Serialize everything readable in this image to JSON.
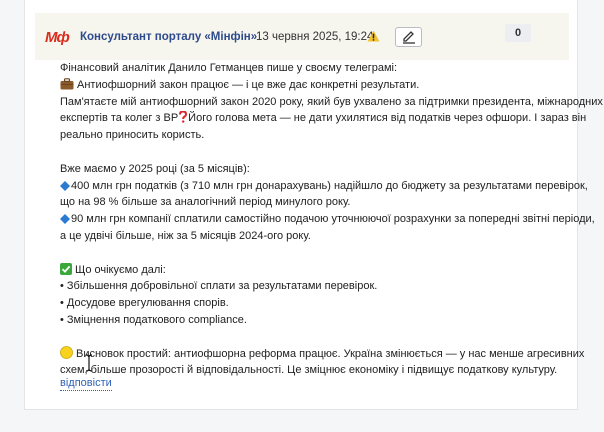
{
  "post": {
    "logo_text": "Мф",
    "author": "Консультант порталу «Мінфін»",
    "date": "13 червня 2025, 19:24",
    "count": "0",
    "lines": [
      "Фінансовий аналітик Данило Гетманцев пише у своєму телеграмі:",
      "Антиофшорний закон працює — і це вже дає конкретні результати.",
      "Пам'ятаєте мій антиофшорний закон 2020 року, який був ухвалено за підтримки президента, міжнародних",
      "експертів та колег з ВР",
      "Його голова мета — не дати ухилятися від податків через офшори. І зараз він",
      "реально приносить користь.",
      "Вже маємо у 2025 році (за 5 місяців):",
      "400 млн грн податків (з 710 млн грн донарахувань) надійшло до бюджету за результатами перевірок,",
      "що на 98 % більше за аналогічний період минулого року.",
      "90 млн грн компанії сплатили самостійно подачою уточнюючої розрахунки за попередні звітні періоди,",
      "а це удвічі більше, ніж за 5 місяців 2024-ого року.",
      "Що очікуємо далі:",
      "• Збільшення добровільної сплати за результатами перевірок.",
      "• Досудове врегулювання спорів.",
      "• Зміцнення податкового compliance.",
      "Висновок простий: антиофшорна реформа працює. Україна змінюється — у нас менше агресивних",
      "схем, більше прозорості й відповідальності. Це зміцнює економіку і підвищує податкову культуру."
    ],
    "reply_label": "відповісти"
  },
  "colors": {
    "brand_red": "#d92d20",
    "author_blue": "#2d4a8c",
    "link_blue": "#2d62b8",
    "header_bg": "#f6f5ee"
  },
  "icons": [
    "briefcase-icon",
    "red-question-icon",
    "blue-diamond-icon",
    "green-check-icon",
    "yellow-circle-icon",
    "warning-icon",
    "pencil-icon",
    "text-cursor-icon"
  ]
}
